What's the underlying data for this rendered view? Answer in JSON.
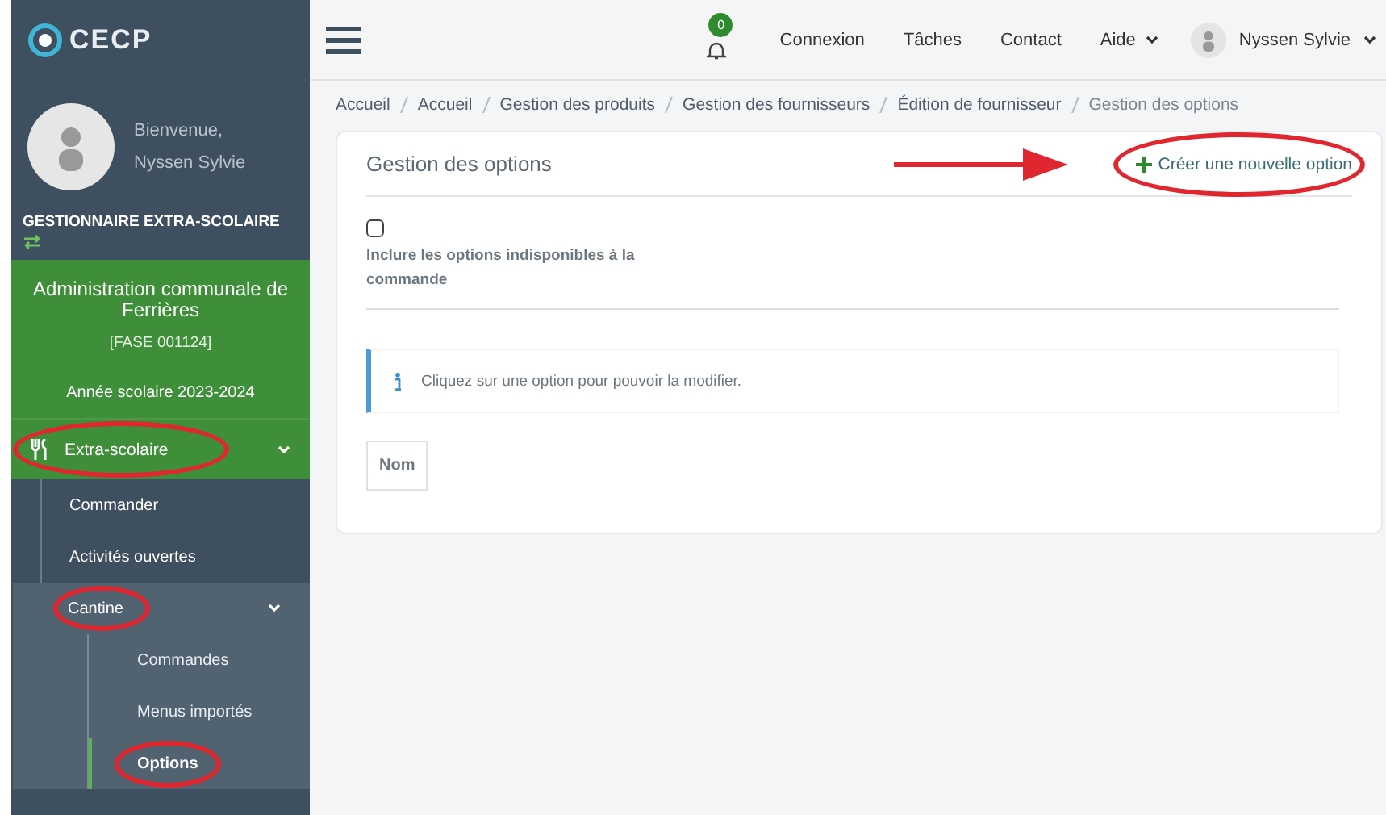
{
  "logo": {
    "text": "CECP"
  },
  "profile": {
    "greeting": "Bienvenue,",
    "name": "Nyssen Sylvie"
  },
  "role": "GESTIONNAIRE EXTRA-SCOLAIRE",
  "organization": {
    "name": "Administration communale de Ferrières",
    "code": "[FASE 001124]",
    "school_year": "Année scolaire 2023-2024"
  },
  "menu": [
    {
      "label": "Extra-scolaire",
      "expanded": true,
      "circled": true,
      "children": [
        {
          "label": "Commander"
        },
        {
          "label": "Activités ouvertes"
        },
        {
          "label": "Cantine",
          "expanded": true,
          "circled": true,
          "children": [
            {
              "label": "Commandes",
              "selected": false,
              "circled": false
            },
            {
              "label": "Menus importés",
              "selected": false,
              "circled": false
            },
            {
              "label": "Options",
              "selected": true,
              "circled": true
            }
          ]
        }
      ]
    }
  ],
  "topbar": {
    "notification_count": "0",
    "links": [
      {
        "label": "Connexion",
        "kind": "link"
      },
      {
        "label": "Tâches",
        "kind": "link"
      },
      {
        "label": "Contact",
        "kind": "link"
      },
      {
        "label": "Aide",
        "kind": "dropdown"
      }
    ],
    "user": "Nyssen Sylvie"
  },
  "breadcrumb": [
    "Accueil",
    "Accueil",
    "Gestion des produits",
    "Gestion des fournisseurs",
    "Édition de fournisseur",
    "Gestion des options"
  ],
  "card": {
    "title": "Gestion des options",
    "action": {
      "label": "Créer une nouvelle option",
      "circled": true,
      "arrow": true
    },
    "checkbox": {
      "label": "Inclure les options indisponibles à la commande",
      "checked": false
    },
    "info": "Cliquez sur une option pour pouvoir la modifier.",
    "table": {
      "columns": [
        "Nom"
      ]
    }
  }
}
